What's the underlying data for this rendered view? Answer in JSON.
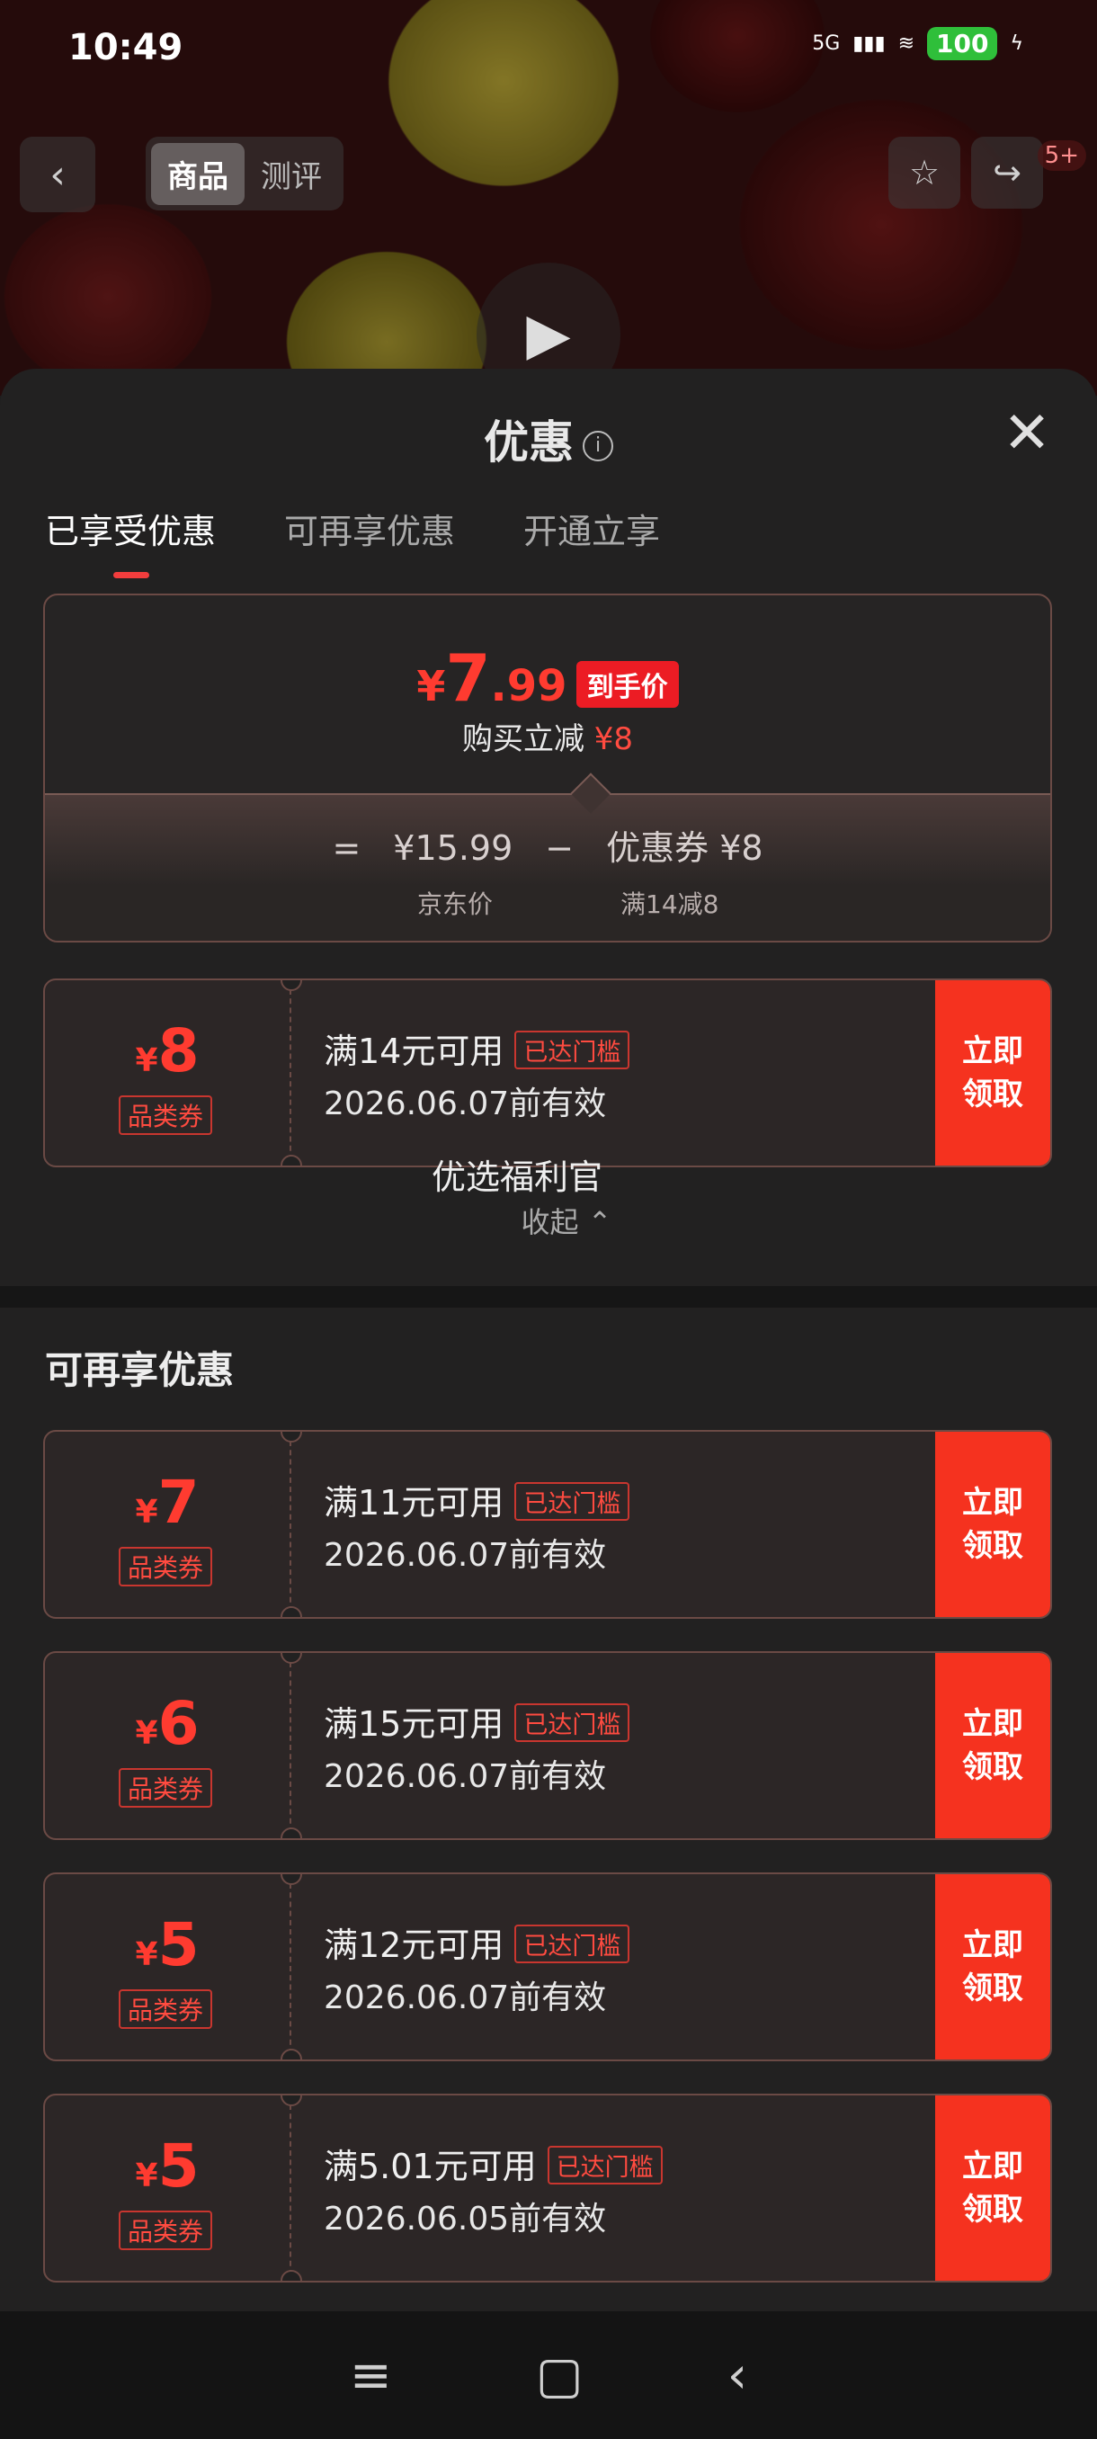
{
  "status_bar": {
    "time": "10:49",
    "network": "5G",
    "battery": "100"
  },
  "header": {
    "tabs": [
      "商品",
      "测评"
    ],
    "badge": "5+"
  },
  "sheet": {
    "title": "优惠",
    "tabs": [
      "已享受优惠",
      "可再享优惠",
      "开通立享"
    ],
    "summary": {
      "yen": "¥",
      "price_int": "7",
      "price_dec": ".99",
      "price_tag": "到手价",
      "buy_reduce_label": "购买立减",
      "buy_reduce_value": "¥8",
      "eq": "=",
      "jd_price": "¥15.99",
      "minus": "−",
      "coupon_label": "优惠券 ¥8",
      "jd_price_label": "京东价",
      "coupon_rule": "满14减8"
    },
    "applied_coupon": {
      "yen": "¥",
      "amount": "8",
      "type": "品类券",
      "title": "满14元可用",
      "tag": "已达门槛",
      "date": "2026.06.07前有效",
      "button": "立即\n领取"
    },
    "overlay_text": "优选福利官",
    "collapse": "收起 ⌃",
    "more_section_title": "可再享优惠",
    "more_coupons": [
      {
        "yen": "¥",
        "amount": "7",
        "type": "品类券",
        "title": "满11元可用",
        "tag": "已达门槛",
        "date": "2026.06.07前有效",
        "button": "立即\n领取"
      },
      {
        "yen": "¥",
        "amount": "6",
        "type": "品类券",
        "title": "满15元可用",
        "tag": "已达门槛",
        "date": "2026.06.07前有效",
        "button": "立即\n领取"
      },
      {
        "yen": "¥",
        "amount": "5",
        "type": "品类券",
        "title": "满12元可用",
        "tag": "已达门槛",
        "date": "2026.06.07前有效",
        "button": "立即\n领取"
      },
      {
        "yen": "¥",
        "amount": "5",
        "type": "品类券",
        "title": "满5.01元可用",
        "tag": "已达门槛",
        "date": "2026.06.05前有效",
        "button": "立即\n领取"
      }
    ]
  },
  "colors": {
    "accent": "#f5321f",
    "price_red": "#ff3b30"
  },
  "icons": [
    "back-icon",
    "star-icon",
    "share-icon",
    "play-icon",
    "info-icon",
    "close-icon",
    "menu-icon",
    "home-icon",
    "nav-back-icon"
  ]
}
